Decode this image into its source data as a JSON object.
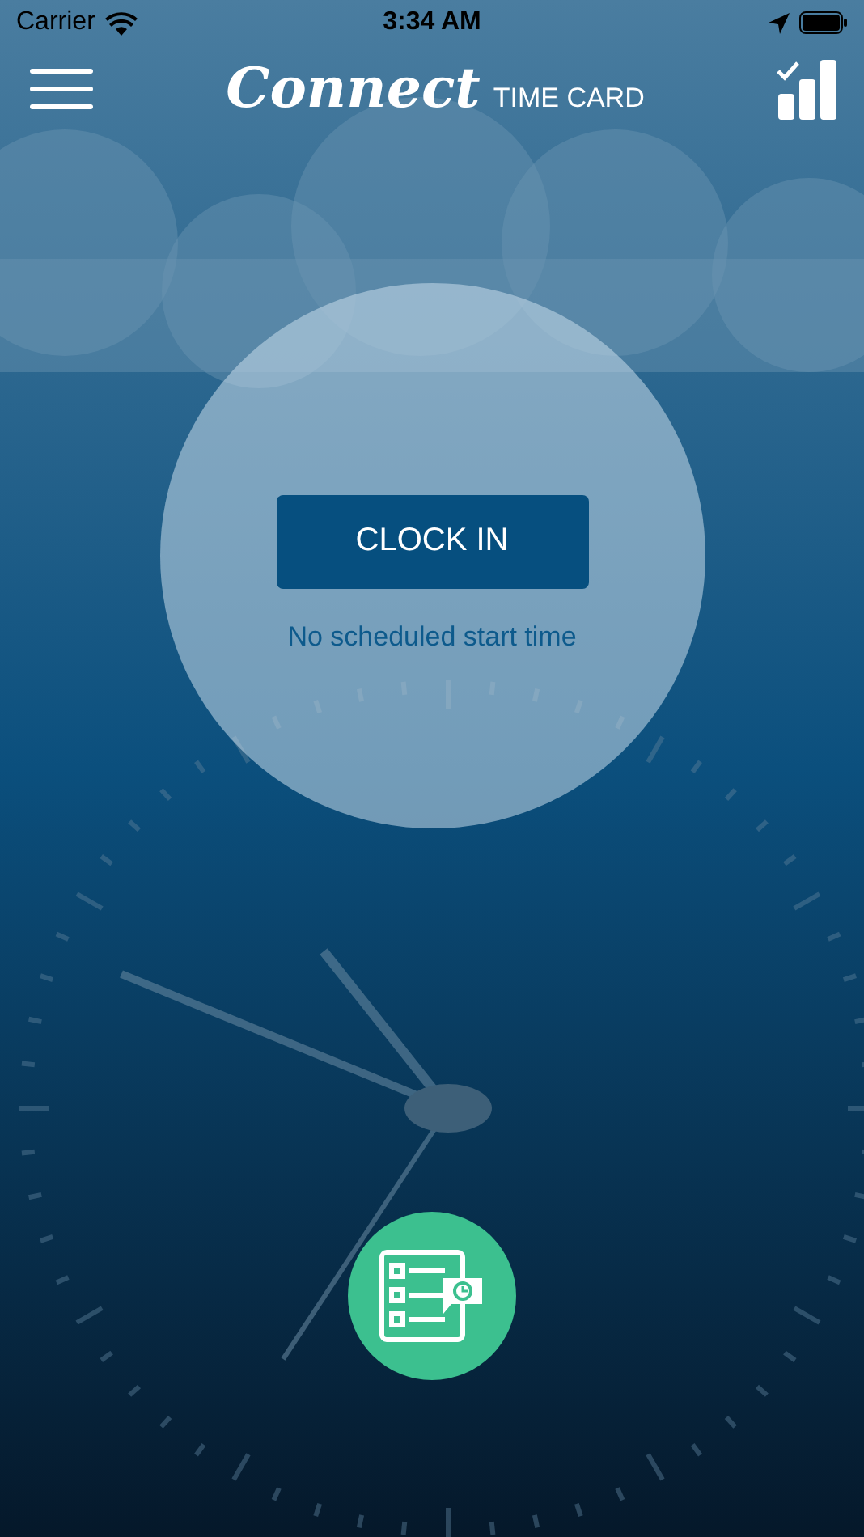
{
  "status_bar": {
    "carrier": "Carrier",
    "time": "3:34 AM"
  },
  "header": {
    "logo": "Connect",
    "title": "TIME CARD"
  },
  "clock_in": {
    "button": "CLOCK IN",
    "note": "No scheduled start time"
  }
}
